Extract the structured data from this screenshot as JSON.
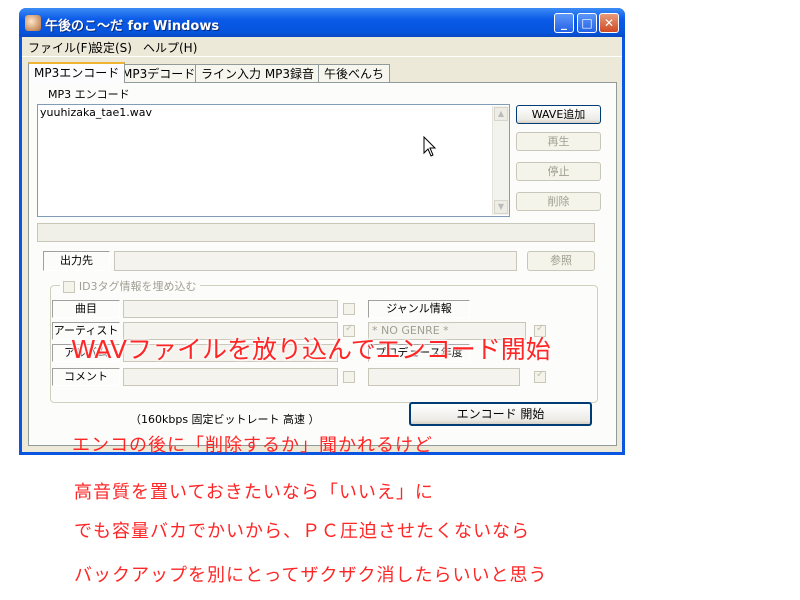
{
  "window": {
    "title": "午後のこ～だ for Windows",
    "minimize": "_",
    "maximize": "□",
    "close": "✕"
  },
  "menu": [
    "ファイル(F)",
    "設定(S)",
    "ヘルプ(H)"
  ],
  "tabs": [
    "MP3エンコード",
    "MP3デコード",
    "ライン入力 MP3録音",
    "午後べんち"
  ],
  "encode": {
    "section_label": "MP3 エンコード",
    "files": [
      "yuuhizaka_tae1.wav"
    ],
    "buttons": {
      "add_wave": "WAVE追加",
      "play": "再生",
      "stop": "停止",
      "delete": "削除",
      "browse": "参照",
      "start": "エンコード 開始"
    },
    "output_label": "出力先",
    "id3": {
      "checkbox_label": "ID3タグ情報を埋め込む",
      "song": "曲目",
      "artist": "アーティスト",
      "album": "アルバム",
      "comment": "コメント",
      "genre_label": "ジャンル情報",
      "genre_value": "* NO GENRE *",
      "year_label": "プロデュース年度"
    },
    "bitrate_info": "（160kbps  固定ビットレート 高速 ）"
  },
  "annotations": {
    "headline": "WAVファイルを放り込んでエンコード開始",
    "lines": [
      "エンコの後に「削除するか」聞かれるけど",
      "高音質を置いておきたいなら「いいえ」に",
      "でも容量バカでかいから、ＰＣ圧迫させたくないなら",
      "バックアップを別にとってザクザク消したらいいと思う"
    ]
  }
}
